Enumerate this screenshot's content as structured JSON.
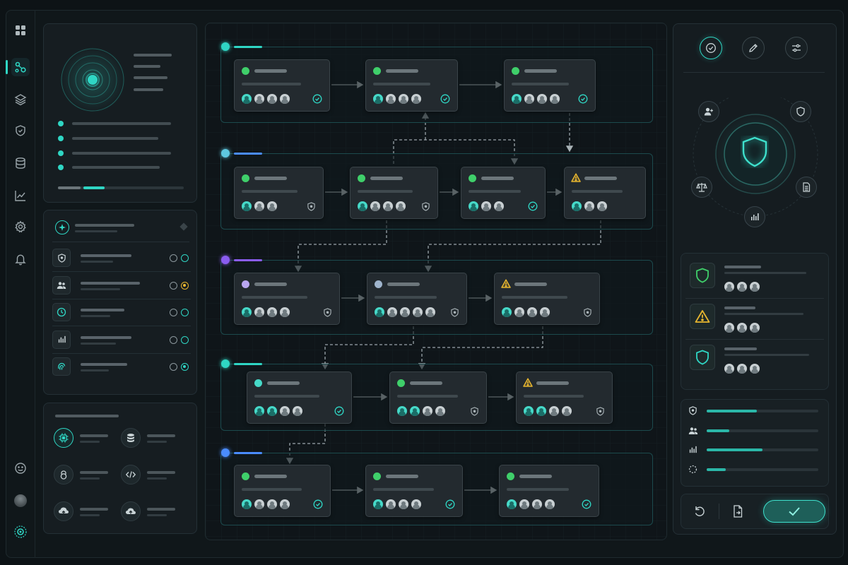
{
  "app": {
    "accent": "#2fd6c4",
    "status_colors": {
      "ok": "#3fcf6a",
      "warn": "#e8b62f",
      "info": "#4aa8ff",
      "purple": "#8a5cf0"
    }
  },
  "sidebar_rail": {
    "items": [
      {
        "icon": "grid-icon",
        "active": false
      },
      {
        "icon": "workflow-icon",
        "active": true
      },
      {
        "icon": "layers-icon",
        "active": false
      },
      {
        "icon": "shield-icon",
        "active": false
      },
      {
        "icon": "database-icon",
        "active": false
      },
      {
        "icon": "chart-icon",
        "active": false
      },
      {
        "icon": "gear-icon",
        "active": false
      },
      {
        "icon": "bell-icon",
        "active": false
      }
    ],
    "bottom": [
      "smiley-icon",
      "avatar",
      "settings-dial-icon"
    ]
  },
  "overview_panel": {
    "progress": 0.35
  },
  "policy_list": {
    "items": [
      {
        "icon": "shield-icon",
        "state": "on"
      },
      {
        "icon": "users-icon",
        "state": "warn"
      },
      {
        "icon": "clock-icon",
        "state": "on"
      },
      {
        "icon": "bar-chart-icon",
        "state": "on"
      },
      {
        "icon": "fingerprint-icon",
        "state": "partial"
      }
    ]
  },
  "services": {
    "items": [
      "chip-icon",
      "database-icon",
      "lock-icon",
      "code-icon",
      "cloud-upload-icon",
      "cloud-icon"
    ]
  },
  "workflow": {
    "lanes": [
      {
        "color": "#2fd6c4",
        "bar": "#2fd6c4",
        "cards": [
          {
            "status": "ok",
            "avatars": 4,
            "badge": "check"
          },
          {
            "status": "ok",
            "avatars": 4,
            "badge": "check"
          },
          {
            "status": "ok",
            "avatars": 4,
            "badge": "check"
          }
        ]
      },
      {
        "color": "#5ec8e0",
        "bar": "#4a8cff",
        "cards": [
          {
            "status": "ok",
            "avatars": 3,
            "badge": "shield"
          },
          {
            "status": "ok",
            "avatars": 4,
            "badge": "shield"
          },
          {
            "status": "ok",
            "avatars": 3,
            "badge": "check"
          },
          {
            "status": "warn",
            "avatars": 3,
            "badge": "none"
          }
        ]
      },
      {
        "color": "#8a5cf0",
        "bar": "#8a5cf0",
        "cards": [
          {
            "status": "purple",
            "avatars": 4,
            "badge": "shield"
          },
          {
            "status": "grey",
            "avatars": 5,
            "badge": "shield"
          },
          {
            "status": "warn",
            "avatars": 4,
            "badge": "shield"
          }
        ]
      },
      {
        "color": "#2fd6c4",
        "bar": "#2fd6c4",
        "cards": [
          {
            "status": "info",
            "avatars": 4,
            "badge": "check"
          },
          {
            "status": "ok",
            "avatars": 4,
            "badge": "shield"
          },
          {
            "status": "warn",
            "avatars": 4,
            "badge": "shield"
          }
        ]
      },
      {
        "color": "#4a8cff",
        "bar": "#4a8cff",
        "cards": [
          {
            "status": "ok",
            "avatars": 4,
            "badge": "check"
          },
          {
            "status": "ok",
            "avatars": 4,
            "badge": "check"
          },
          {
            "status": "ok",
            "avatars": 4,
            "badge": "check"
          }
        ]
      }
    ]
  },
  "right_panel": {
    "tools": [
      "check-circle-icon",
      "pencil-icon",
      "sliders-icon"
    ],
    "orbit_icons": [
      "add-user-icon",
      "shield-icon",
      "scale-icon",
      "document-icon",
      "bar-chart-icon"
    ],
    "checks": [
      {
        "icon": "shield-icon",
        "color": "#3fcf6a"
      },
      {
        "icon": "warning-icon",
        "color": "#e8b62f"
      },
      {
        "icon": "shield-icon",
        "color": "#2fd6c4"
      }
    ],
    "stats": [
      {
        "icon": "shield-icon",
        "value": 0.45
      },
      {
        "icon": "users-icon",
        "value": 0.2
      },
      {
        "icon": "bar-chart-icon",
        "value": 0.5
      },
      {
        "icon": "spinner-icon",
        "value": 0.17
      }
    ],
    "actions": [
      "undo-icon",
      "export-icon",
      "confirm-check-icon"
    ]
  }
}
